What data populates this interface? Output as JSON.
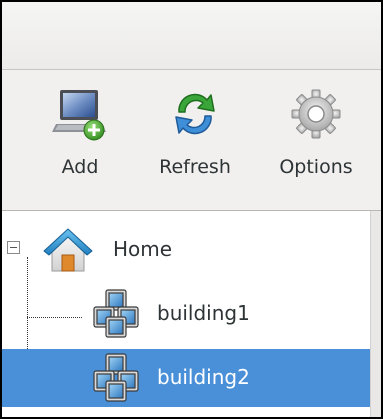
{
  "toolbar": {
    "add_label": "Add",
    "refresh_label": "Refresh",
    "options_label": "Options"
  },
  "tree": {
    "root": {
      "label": "Home",
      "expanded": true,
      "icon": "home-icon"
    },
    "children": [
      {
        "label": "building1",
        "icon": "building-icon",
        "selected": false
      },
      {
        "label": "building2",
        "icon": "building-icon",
        "selected": true
      }
    ]
  },
  "colors": {
    "selection": "#4a90d9",
    "window_bg": "#f3f2f1",
    "tree_bg": "#ffffff",
    "text": "#2e3436"
  }
}
